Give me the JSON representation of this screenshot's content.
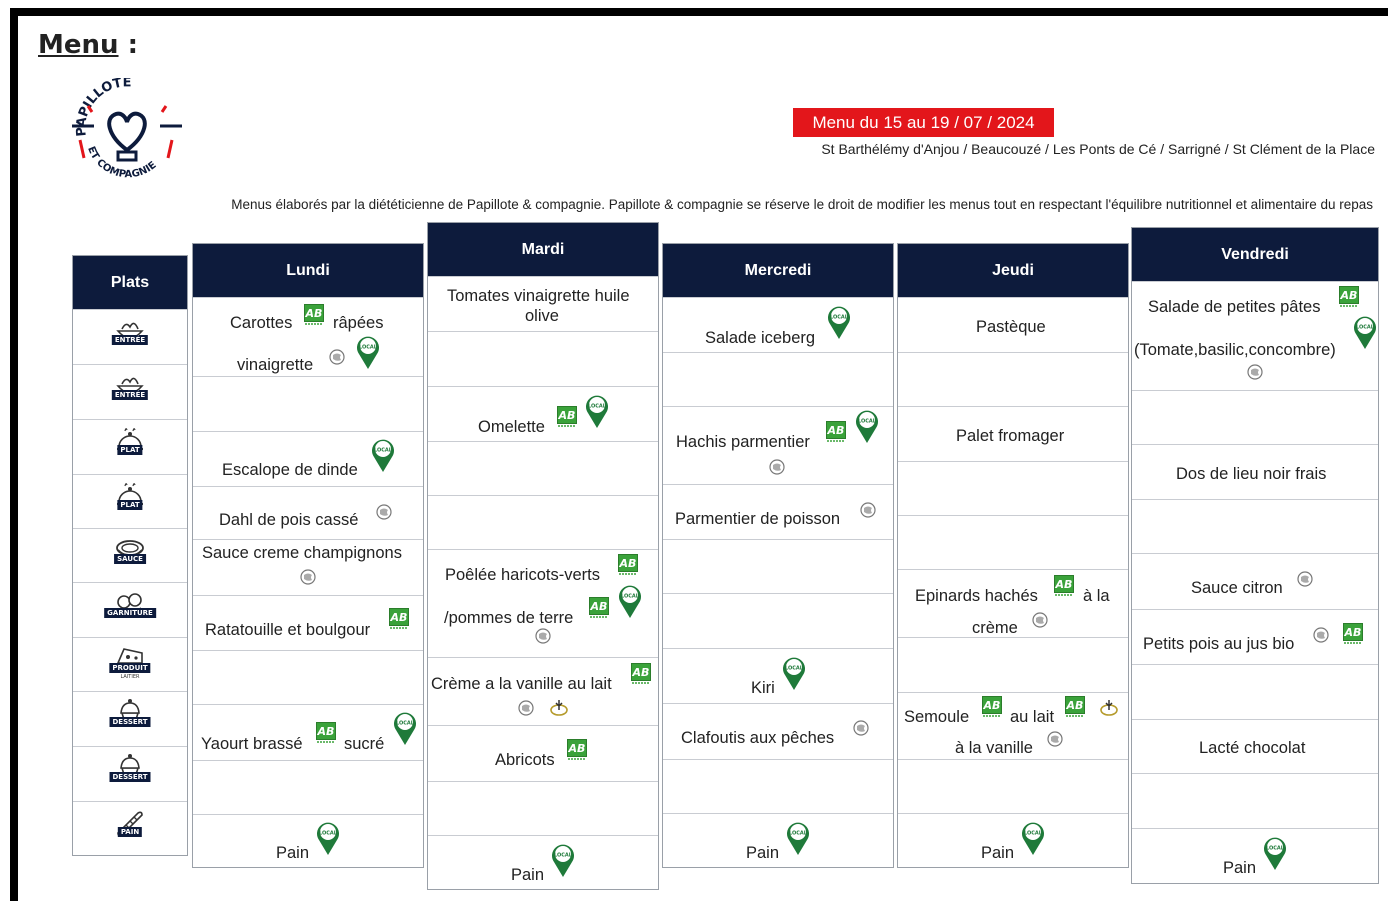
{
  "header": {
    "menu_word": "Menu",
    "menu_colon": " :",
    "logo_top": "PAPILLOTE",
    "logo_bottom": "ET COMPAGNIE",
    "dates": "Menu du 15 au 19 / 07 / 2024",
    "towns": "St Barthélémy d'Anjou / Beaucouzé / Les Ponts de Cé / Sarrigné / St Clément de la Place",
    "disclaimer": "Menus élaborés par la diététicienne de Papillote & compagnie. Papillote & compagnie se réserve le droit de modifier les menus tout en respectant l'équilibre nutritionnel et alimentaire du repas"
  },
  "plats": {
    "title": "Plats",
    "rows": [
      {
        "label": "ENTRÉE",
        "icon": "salad-bowl-icon"
      },
      {
        "label": "ENTRÉE",
        "icon": "salad-bowl-icon"
      },
      {
        "label": "PLAT",
        "icon": "cloche-icon"
      },
      {
        "label": "PLAT",
        "icon": "cloche-icon"
      },
      {
        "label": "SAUCE",
        "icon": "sauce-bowl-icon"
      },
      {
        "label": "GARNITURE",
        "icon": "vegetables-icon"
      },
      {
        "label": "PRODUIT",
        "sub": "LAITIER",
        "icon": "cheese-icon"
      },
      {
        "label": "DESSERT",
        "icon": "cupcake-icon"
      },
      {
        "label": "DESSERT",
        "icon": "cupcake-icon"
      },
      {
        "label": "PAIN",
        "icon": "baguette-icon"
      }
    ]
  },
  "days": {
    "lundi": {
      "name": "Lundi",
      "items": {
        "entree1a": "Carottes",
        "entree1b": "râpées",
        "entree1c": "vinaigrette",
        "plat1": "Escalope de dinde",
        "plat2": "Dahl de pois cassé",
        "sauce": "Sauce creme champignons",
        "garniture": "Ratatouille et boulgour",
        "dessert1a": "Yaourt brassé",
        "dessert1b": "sucré",
        "pain": "Pain"
      }
    },
    "mardi": {
      "name": "Mardi",
      "items": {
        "entree1a": "Tomates vinaigrette huile",
        "entree1b": "olive",
        "plat1": "Omelette",
        "garniture1": "Poêlée haricots-verts",
        "garniture2": "/pommes de terre",
        "laitier": "Crème a la vanille au lait",
        "dessert": "Abricots",
        "pain": "Pain"
      }
    },
    "mercredi": {
      "name": "Mercredi",
      "items": {
        "entree1": "Salade iceberg",
        "plat1": "Hachis parmentier",
        "plat2": "Parmentier de poisson",
        "laitier": "Kiri",
        "dessert": "Clafoutis aux pêches",
        "pain": "Pain"
      }
    },
    "jeudi": {
      "name": "Jeudi",
      "items": {
        "entree1": "Pastèque",
        "plat1": "Palet fromager",
        "garniture1": "Epinards hachés",
        "garniture2": "à la",
        "garniture3": "crème",
        "dessert1a": "Semoule",
        "dessert1b": "au lait",
        "dessert1c": "à la vanille",
        "pain": "Pain"
      }
    },
    "vendredi": {
      "name": "Vendredi",
      "items": {
        "entree1a": "Salade de petites pâtes",
        "entree1b": "(Tomate,basilic,concombre)",
        "plat1": "Dos de lieu noir frais",
        "sauce": "Sauce citron",
        "garniture": "Petits pois au jus bio",
        "dessert": "Lacté chocolat",
        "pain": "Pain"
      }
    }
  },
  "badges": {
    "bio": "AB",
    "local": "LOCAL"
  },
  "colors": {
    "header_navy": "#0d1b3c",
    "date_red": "#e3161b",
    "bio_green": "#3aa23a",
    "local_green": "#1f7a3a"
  }
}
